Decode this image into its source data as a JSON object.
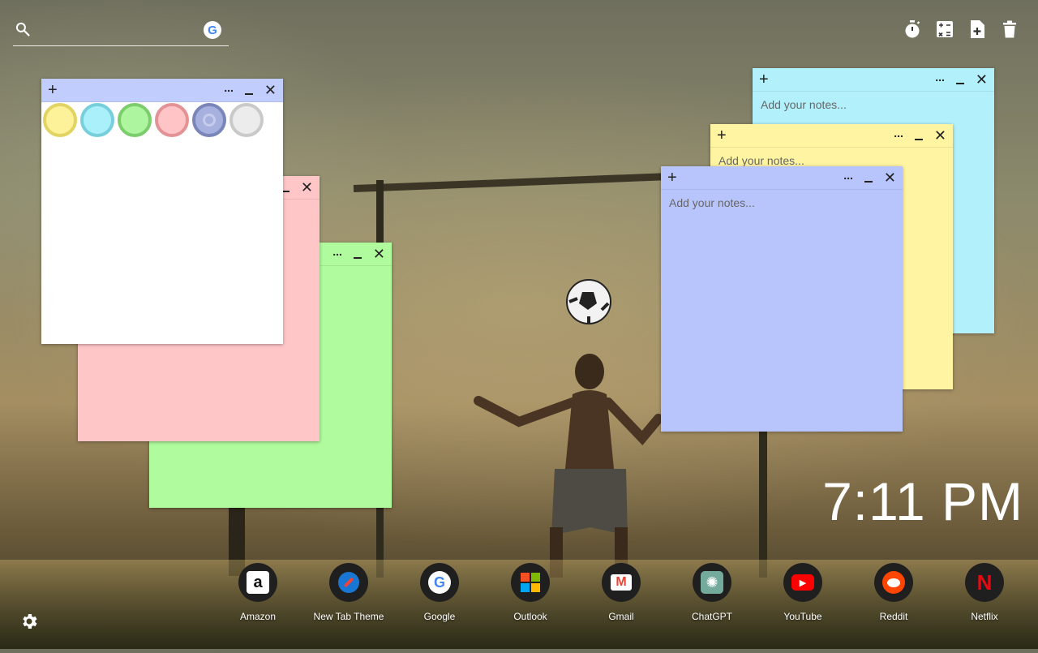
{
  "search": {
    "placeholder": "",
    "engine_icon": "google-icon",
    "engine_letter": "G"
  },
  "toolbar": {
    "icons": [
      "stopwatch-icon",
      "calculator-icon",
      "add-note-icon",
      "trash-icon"
    ]
  },
  "palette": {
    "colors": [
      "#fdf19a",
      "#a9f0fb",
      "#aef5a0",
      "#ffc4c5",
      "#a6b1e0",
      "#ececec"
    ],
    "borders": [
      "#e2d463",
      "#78cfdc",
      "#7ccd6c",
      "#e39396",
      "#7b86b8",
      "#c9c9c9"
    ],
    "selected": 4
  },
  "notes": {
    "placeholder": "Add your notes...",
    "colors": {
      "cyan": "#b2f1fb",
      "yellow": "#fff4a2",
      "blue": "#b8c5fd",
      "pink": "#ffc6c8",
      "green": "#b0fb9d",
      "white": "#ffffff",
      "white_bar": "#c1cdfd"
    }
  },
  "clock": {
    "time": "7:11 PM"
  },
  "shortcuts": [
    {
      "label": "Amazon",
      "icon": "amazon-icon",
      "glyph": "a"
    },
    {
      "label": "New Tab Theme",
      "icon": "compass-icon",
      "glyph": ""
    },
    {
      "label": "Google",
      "icon": "google-icon",
      "glyph": "G"
    },
    {
      "label": "Outlook",
      "icon": "microsoft-icon",
      "glyph": ""
    },
    {
      "label": "Gmail",
      "icon": "gmail-icon",
      "glyph": "M"
    },
    {
      "label": "ChatGPT",
      "icon": "openai-icon",
      "glyph": "✺"
    },
    {
      "label": "YouTube",
      "icon": "youtube-icon",
      "glyph": "▶"
    },
    {
      "label": "Reddit",
      "icon": "reddit-icon",
      "glyph": ""
    },
    {
      "label": "Netflix",
      "icon": "netflix-icon",
      "glyph": "N"
    }
  ]
}
